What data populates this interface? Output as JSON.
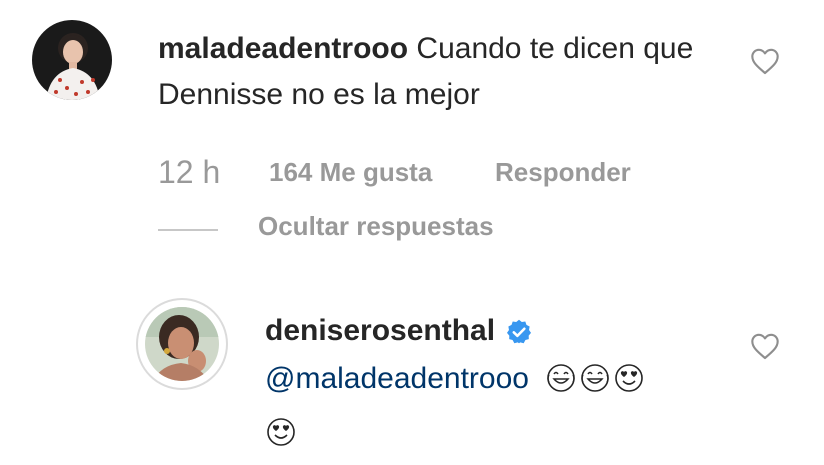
{
  "comment": {
    "username": "maladeadentrooo",
    "text": "Cuando te dicen que Dennisse no es la mejor",
    "time": "12 h",
    "likes": "164 Me gusta",
    "reply_label": "Responder",
    "hide_replies_label": "Ocultar respuestas"
  },
  "reply": {
    "username": "deniserosenthal",
    "verified": true,
    "mention": "@maladeadentrooo",
    "emojis_line1": [
      "laughing-tears-emoji",
      "laughing-tears-emoji",
      "heart-eyes-emoji"
    ],
    "emojis_line2": [
      "heart-eyes-emoji"
    ]
  },
  "colors": {
    "text": "#262626",
    "muted": "#999999",
    "mention": "#003569",
    "verified": "#3897f0"
  }
}
